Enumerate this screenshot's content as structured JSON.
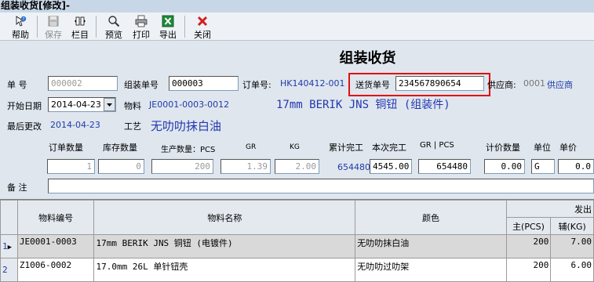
{
  "window": {
    "title": "组装收货[修改]-"
  },
  "toolbar": {
    "items": [
      {
        "label": "帮助",
        "icon": "help-icon"
      },
      {
        "label": "保存",
        "icon": "save-icon",
        "disabled": true
      },
      {
        "label": "栏目",
        "icon": "columns-icon"
      },
      {
        "label": "预览",
        "icon": "preview-icon"
      },
      {
        "label": "打印",
        "icon": "print-icon"
      },
      {
        "label": "导出",
        "icon": "excel-export-icon"
      },
      {
        "label": "关闭",
        "icon": "close-icon"
      }
    ]
  },
  "form": {
    "title": "组装收货",
    "doc_no_label": "单    号",
    "doc_no": "000002",
    "assembly_no_label": "组装单号",
    "assembly_no": "000003",
    "order_no_label": "订单号:",
    "order_no": "HK140412-001",
    "delivery_no_label": "送货单号",
    "delivery_no": "234567890654",
    "supplier_label": "供应商:",
    "supplier_code": "0001",
    "supplier_name": "供应商",
    "start_date_label": "开始日期",
    "start_date": "2014-04-23",
    "material_label": "物料",
    "material_code": "JE0001-0003-0012",
    "material_desc": "17mm BERIK JNS 铜钮 (组装件)",
    "last_modified_label": "最后更改",
    "last_modified": "2014-04-23",
    "process_label": "工艺",
    "process": "无叻叻抹白油",
    "remark_label": "备    注",
    "remark": ""
  },
  "quantities": {
    "headers": {
      "order_qty": "订单数量",
      "stock_qty": "库存数量",
      "produced_qty": "生产数量：PCS",
      "gr": "GR",
      "kg": "KG",
      "cumulative": "累计完工",
      "current": "本次完工",
      "gr_pcs": "GR | PCS",
      "price_qty": "计价数量",
      "unit": "单位",
      "unit_price": "单价"
    },
    "values": {
      "order_qty": "1",
      "stock_qty": "0",
      "produced_qty": "200",
      "gr": "1.39",
      "kg": "2.00",
      "cumulative": "654480",
      "current": "4545.00",
      "gr_pcs": "654480",
      "price_qty": "0.00",
      "unit": "G",
      "unit_price": "0.0"
    }
  },
  "grid": {
    "headers": {
      "code": "物料编号",
      "name": "物料名称",
      "color": "颜色",
      "issued": "发出",
      "main_pcs": "主(PCS)",
      "aux_kg": "辅(KG)"
    },
    "rows": [
      {
        "idx": "1",
        "code": "JE0001-0003",
        "name": "17mm BERIK JNS 铜钮 (电镀件)",
        "color": "无叻叻抹白油",
        "pcs": "200",
        "kg": "7.00"
      },
      {
        "idx": "2",
        "code": "Z1006-0002",
        "name": "17.0mm 26L 单针钮壳",
        "color": "无叻叻过叻架",
        "pcs": "200",
        "kg": "6.00"
      }
    ]
  },
  "colors": {
    "accent_blue": "#1f3ba8",
    "highlight_red": "#e01010"
  }
}
